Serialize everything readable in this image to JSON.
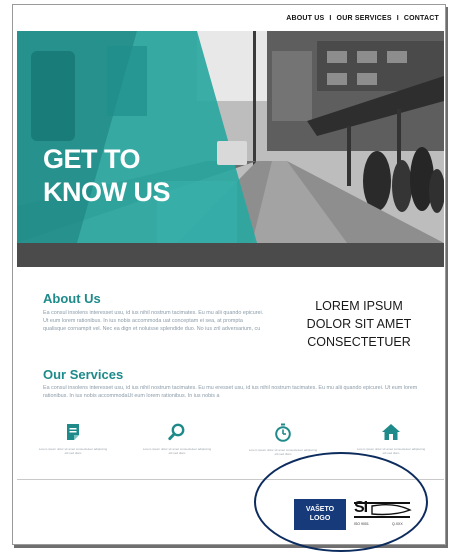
{
  "nav": {
    "items": [
      {
        "label": "ABOUT US"
      },
      {
        "label": "OUR SERVICES"
      },
      {
        "label": "CONTACT"
      }
    ],
    "separator": "I"
  },
  "hero": {
    "title_line1": "GET TO",
    "title_line2": "KNOW US",
    "overlay_color": "#2aa7a1"
  },
  "about": {
    "title": "About Us",
    "text": "Ea consul insolens interesset usu, id ius nihil nostrum tacimates. Eu mu alii quando epicurei. Ut eum lorem rationibus. In ius nobis accommoda uat conceptam ei sea, at prompta qualisque cornampit vel. Nec ea dign et noluisse splendide duo. No ius zril adversarium, cu"
  },
  "tagline": {
    "line1": "LOREM IPSUM",
    "line2": "DOLOR SIT AMET",
    "line3": "CONSECTETUER"
  },
  "services": {
    "title": "Our Services",
    "text": "Ea consul insolens interesset usu, id ius nihil nostrum tacimates. Eu mu eresset usu, id ius nihil nostrum tacimates. Eu mu alii quando epicurei. Ut eum lorem rationibus. In ius nobis accommodaUt eum lorem rationibus. In ius nobis a",
    "items": [
      {
        "icon": "document-icon",
        "caption": "Lorem ipsum dolor sit amet consectetuer adipiscing elit sed diam"
      },
      {
        "icon": "search-icon",
        "caption": "Lorem ipsum dolor sit amet consectetuer adipiscing elit sed diam"
      },
      {
        "icon": "stopwatch-icon",
        "caption": "Lorem ipsum dolor sit amet consectetuer adipiscing elit sed diam"
      },
      {
        "icon": "home-icon",
        "caption": "Lorem ipsum dolor sit amet consectetuer adipiscing elit sed diam"
      }
    ],
    "icon_color": "#1f8a8a"
  },
  "footer": {
    "logo_line1": "VAŠETO",
    "logo_line2": "LOGO",
    "cert_mark": "SI",
    "cert_left": "ISO 9001",
    "cert_right": "Q.XXX"
  },
  "colors": {
    "accent": "#1f8a8a",
    "logo_bg": "#173a7a",
    "ellipse": "#0d2c5e"
  }
}
